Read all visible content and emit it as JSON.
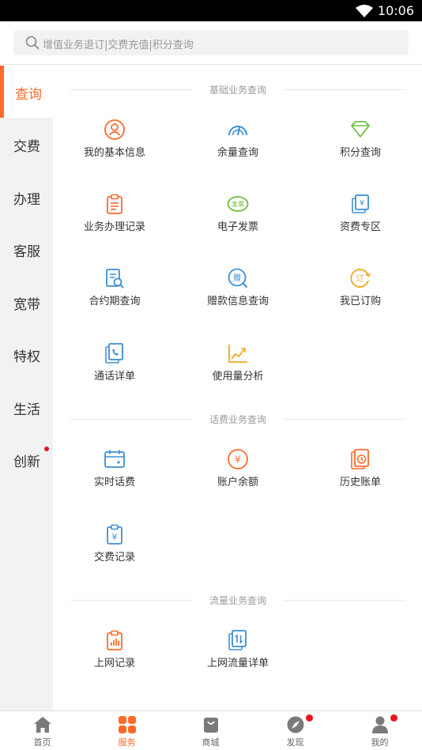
{
  "status_bar": {
    "time": "10:06"
  },
  "search": {
    "placeholder": "增值业务退订|交费充值|积分查询"
  },
  "sidebar": {
    "items": [
      {
        "label": "查询",
        "active": true
      },
      {
        "label": "交费"
      },
      {
        "label": "办理"
      },
      {
        "label": "客服"
      },
      {
        "label": "宽带"
      },
      {
        "label": "特权"
      },
      {
        "label": "生活"
      },
      {
        "label": "创新",
        "badge_dot": true
      }
    ]
  },
  "sections": [
    {
      "title": "基础业务查询",
      "items": [
        {
          "label": "我的基本信息",
          "icon": "user-circle-icon"
        },
        {
          "label": "余量查询",
          "icon": "gauge-icon"
        },
        {
          "label": "积分查询",
          "icon": "diamond-icon"
        },
        {
          "label": "业务办理记录",
          "icon": "clipboard-icon"
        },
        {
          "label": "电子发票",
          "icon": "invoice-icon",
          "icon_text": "发票"
        },
        {
          "label": "资费专区",
          "icon": "tariff-icon",
          "icon_text": "¥"
        },
        {
          "label": "合约期查询",
          "icon": "document-search-icon"
        },
        {
          "label": "赠款信息查询",
          "icon": "gift-search-icon",
          "icon_text": "赠"
        },
        {
          "label": "我已订购",
          "icon": "subscribed-icon",
          "icon_text": "订"
        },
        {
          "label": "通话详单",
          "icon": "call-record-icon"
        },
        {
          "label": "使用量分析",
          "icon": "trend-chart-icon"
        }
      ]
    },
    {
      "title": "话费业务查询",
      "items": [
        {
          "label": "实时话费",
          "icon": "calendar-icon"
        },
        {
          "label": "账户余额",
          "icon": "yuan-circle-icon",
          "icon_text": "¥"
        },
        {
          "label": "历史账单",
          "icon": "history-bill-icon"
        },
        {
          "label": "交费记录",
          "icon": "payment-record-icon",
          "icon_text": "¥"
        }
      ]
    },
    {
      "title": "流量业务查询",
      "items": [
        {
          "label": "上网记录",
          "icon": "data-record-icon"
        },
        {
          "label": "上网流量详单",
          "icon": "data-detail-icon"
        }
      ]
    }
  ],
  "bottom_nav": [
    {
      "label": "首页",
      "icon": "home-icon"
    },
    {
      "label": "服务",
      "icon": "service-icon",
      "active": true
    },
    {
      "label": "商城",
      "icon": "shop-bag-icon"
    },
    {
      "label": "发现",
      "icon": "compass-icon",
      "badge_dot": true
    },
    {
      "label": "我的",
      "icon": "profile-icon",
      "badge_dot": true
    }
  ],
  "colors": {
    "accent": "#ff6a2a",
    "icon_blue": "#3d8fd6",
    "icon_green": "#6cbf3c",
    "icon_amber": "#f5a623",
    "badge_red": "#e8151c"
  }
}
